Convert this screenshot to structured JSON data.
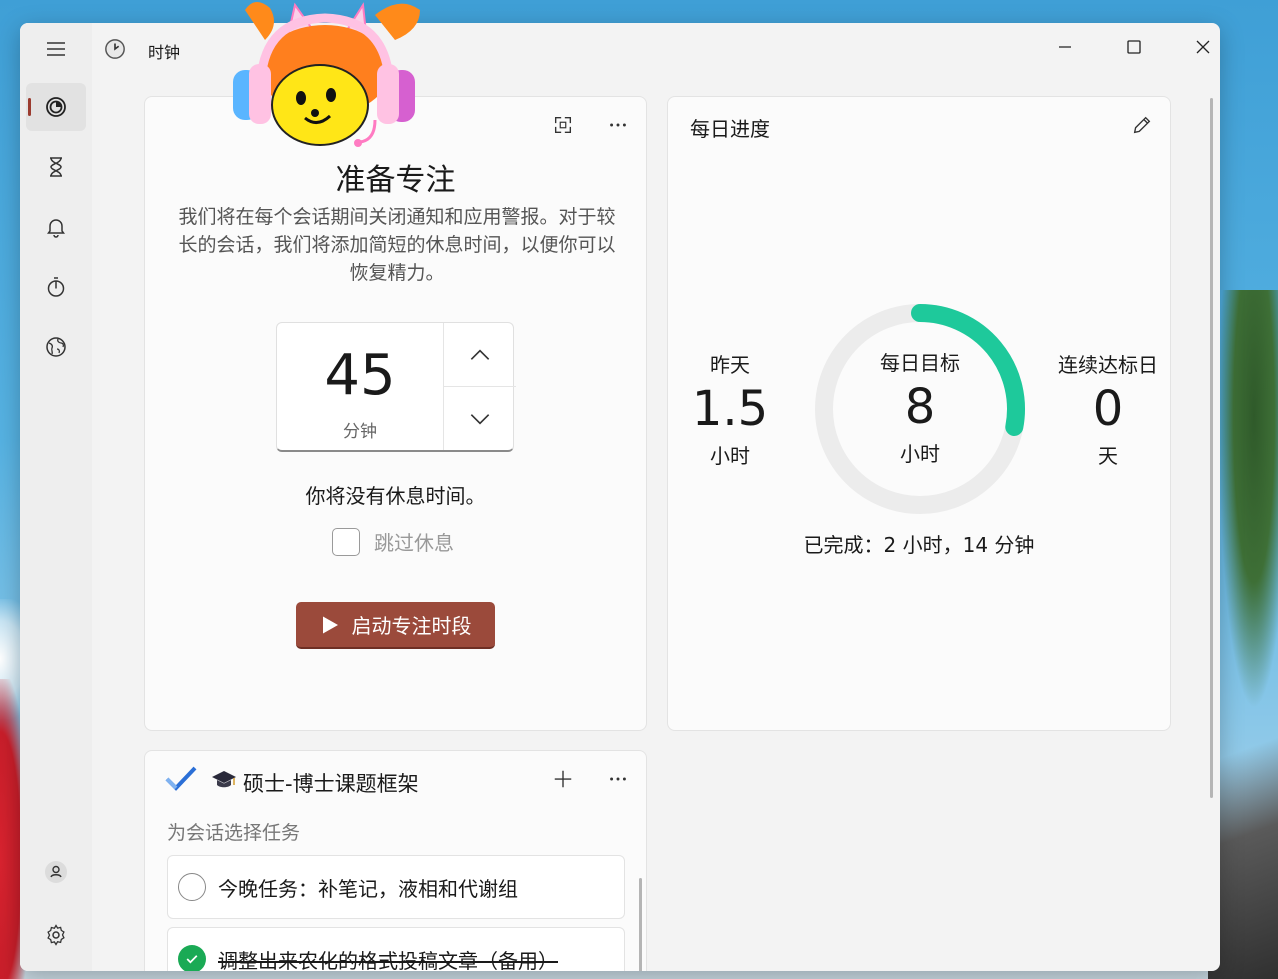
{
  "window": {
    "title": "时钟",
    "accent": "#9b4a3b",
    "progress_color": "#1ec99b"
  },
  "sidebar": {
    "items": [
      {
        "icon": "menu-icon"
      },
      {
        "icon": "focus-icon"
      },
      {
        "icon": "timer-icon"
      },
      {
        "icon": "alarm-icon"
      },
      {
        "icon": "stopwatch-icon"
      },
      {
        "icon": "world-clock-icon"
      }
    ],
    "bottom": [
      {
        "icon": "account-icon"
      },
      {
        "icon": "settings-icon"
      }
    ]
  },
  "focus": {
    "title": "准备专注",
    "description": "我们将在每个会话期间关闭通知和应用警报。对于较长的会话，我们将添加简短的休息时间，以便你可以恢复精力。",
    "minutes_value": "45",
    "minutes_unit": "分钟",
    "break_text": "你将没有休息时间。",
    "skip_break_label": "跳过休息",
    "start_label": "启动专注时段"
  },
  "progress": {
    "title": "每日进度",
    "yesterday_label": "昨天",
    "yesterday_value": "1.5",
    "yesterday_unit": "小时",
    "goal_label": "每日目标",
    "goal_value": "8",
    "goal_unit": "小时",
    "streak_label": "连续达标日",
    "streak_value": "0",
    "streak_unit": "天",
    "completed_text": "已完成：2 小时，14 分钟",
    "goal_fraction": 0.28
  },
  "tasks": {
    "title": "硕士-博士课题框架",
    "subtitle": "为会话选择任务",
    "items": [
      {
        "text": "今晚任务：补笔记，液相和代谢组",
        "done": false
      },
      {
        "text": "调整出来农化的格式投稿文章（备用）",
        "done": true
      }
    ]
  }
}
